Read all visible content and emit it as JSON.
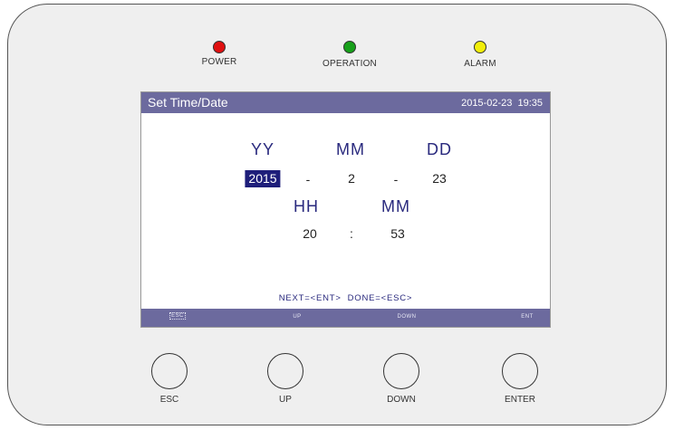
{
  "indicators": [
    {
      "label": "POWER",
      "color": "#e01010"
    },
    {
      "label": "OPERATION",
      "color": "#17a01a"
    },
    {
      "label": "ALARM",
      "color": "#f2ee0a"
    }
  ],
  "screen": {
    "title": "Set Time/Date",
    "clock": "2015-02-23  19:35",
    "date_headers": {
      "year": "YY",
      "month": "MM",
      "day": "DD"
    },
    "date_values": {
      "year": "2015",
      "sep1": "-",
      "month": "2",
      "sep2": "-",
      "day": "23"
    },
    "time_headers": {
      "hour": "HH",
      "minute": "MM"
    },
    "time_values": {
      "hour": "20",
      "sep": ":",
      "minute": "53"
    },
    "hint": "NEXT=<ENT>  DONE=<ESC>",
    "softkeys": {
      "esc": "ESC",
      "up": "UP",
      "down": "DOWN",
      "ent": "ENT"
    }
  },
  "buttons": {
    "esc": "ESC",
    "up": "UP",
    "down": "DOWN",
    "enter": "ENTER"
  }
}
